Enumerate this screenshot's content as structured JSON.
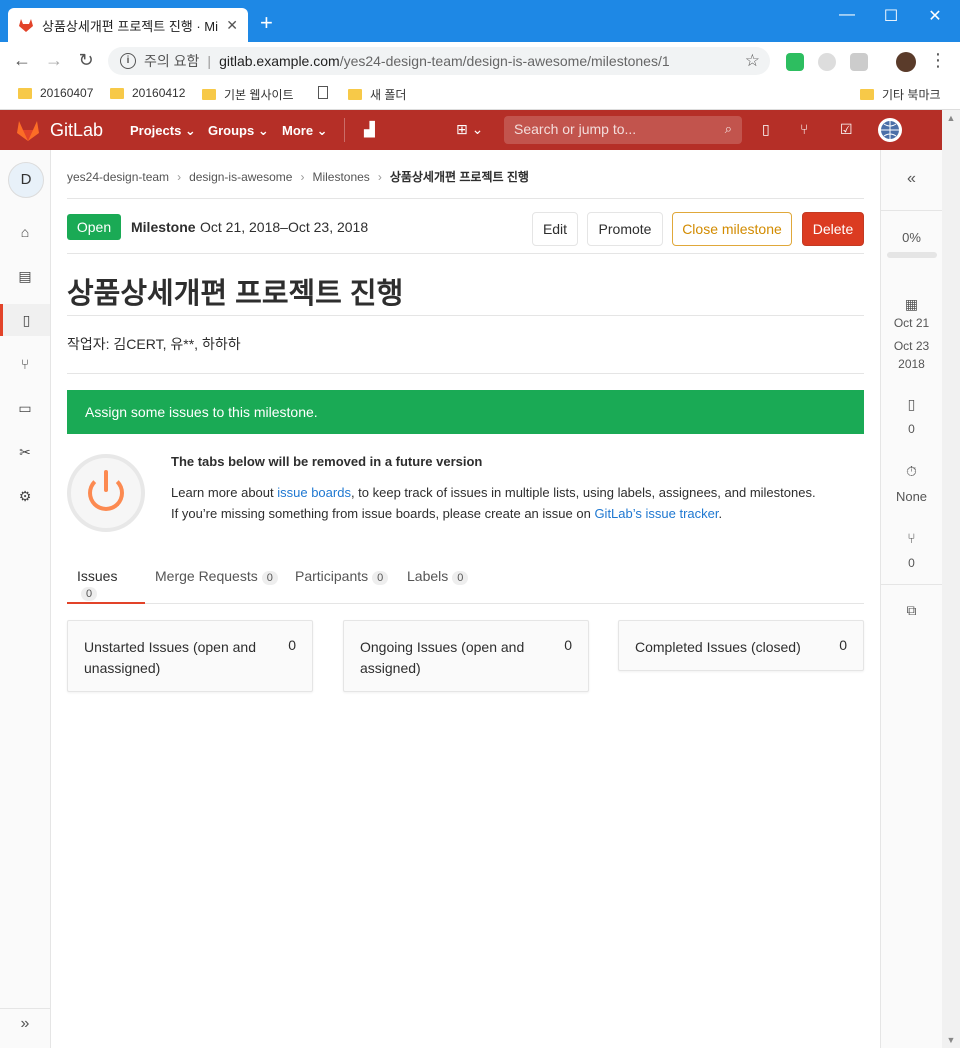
{
  "browser": {
    "tab_title": "상품상세개편 프로젝트 진행 · Mi",
    "new_tab_symbol": "+",
    "url_security": "주의 요함",
    "url_host": "gitlab.example.com",
    "url_path": "/yes24-design-team/design-is-awesome/milestones/1",
    "bookmarks": [
      "20160407",
      "20160412",
      "기본 웹사이트",
      "",
      "새 폴더"
    ],
    "other_bookmarks": "기타 북마크"
  },
  "gitlab_nav": {
    "brand": "GitLab",
    "menus": [
      "Projects ⌄",
      "Groups ⌄",
      "More ⌄"
    ],
    "search_placeholder": "Search or jump to..."
  },
  "sidebar": {
    "project_initial": "D"
  },
  "breadcrumb": {
    "items": [
      "yes24-design-team",
      "design-is-awesome",
      "Milestones"
    ],
    "current": "상품상세개편 프로젝트 진행"
  },
  "milestone": {
    "status": "Open",
    "label": "Milestone",
    "dates": "Oct 21, 2018–Oct 23, 2018",
    "title": "상품상세개편 프로젝트 진행",
    "description": "작업자: 김CERT, 유**, 하하하",
    "buttons": {
      "edit": "Edit",
      "promote": "Promote",
      "close": "Close milestone",
      "delete": "Delete"
    }
  },
  "alert": {
    "text": "Assign some issues to this milestone."
  },
  "promo": {
    "title": "The tabs below will be removed in a future version",
    "line1_pre": "Learn more about ",
    "line1_link": "issue boards",
    "line1_post": ", to keep track of issues in multiple lists, using labels, assignees, and milestones.",
    "line2_pre": "If you’re missing something from issue boards, please create an issue on ",
    "line2_link": "GitLab’s issue tracker",
    "line2_post": "."
  },
  "tabs": [
    {
      "label": "Issues",
      "count": "0"
    },
    {
      "label": "Merge Requests",
      "count": "0"
    },
    {
      "label": "Participants",
      "count": "0"
    },
    {
      "label": "Labels",
      "count": "0"
    }
  ],
  "columns": [
    {
      "label": "Unstarted Issues (open and unassigned)",
      "count": "0"
    },
    {
      "label": "Ongoing Issues (open and assigned)",
      "count": "0"
    },
    {
      "label": "Completed Issues (closed)",
      "count": "0"
    }
  ],
  "right_sidebar": {
    "progress": "0%",
    "progress_value": 0,
    "start_date": "Oct 21",
    "due_date": "Oct 23",
    "due_year": "2018",
    "issues": "0",
    "time_tracking": "None",
    "merge_requests": "0"
  },
  "colors": {
    "navbar": "#b52f27",
    "accent": "#e24329",
    "success": "#1aaa55",
    "danger": "#db3b21",
    "link": "#1f78d1"
  }
}
